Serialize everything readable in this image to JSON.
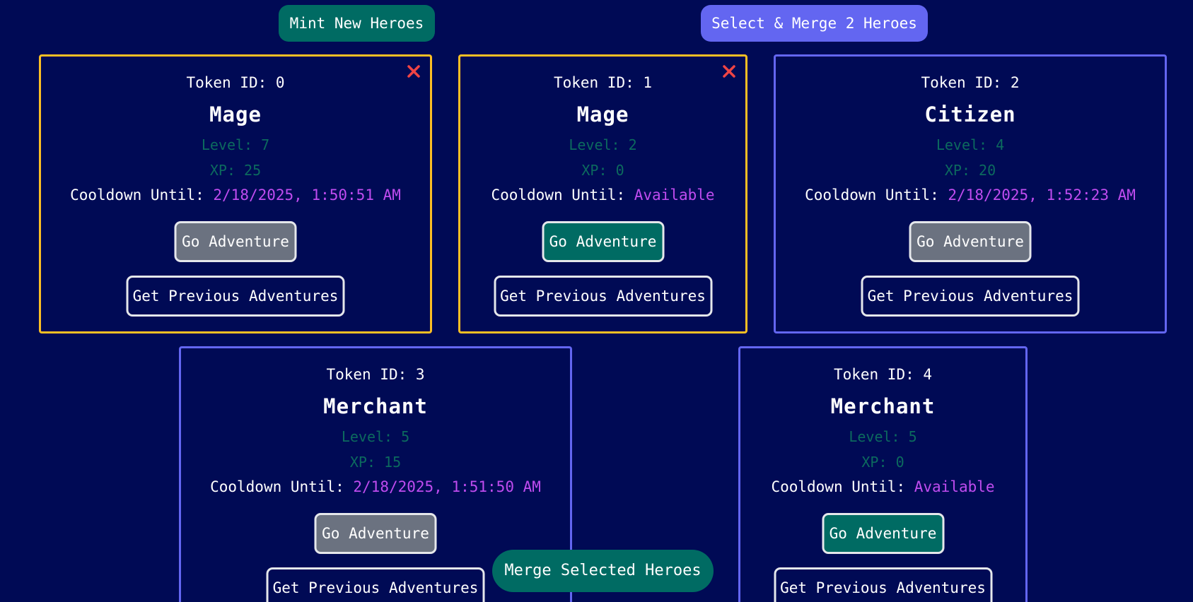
{
  "header": {
    "mint_label": "Mint New Heroes",
    "merge_label": "Select & Merge 2 Heroes"
  },
  "labels": {
    "token_id_prefix": "Token ID: ",
    "level_prefix": "Level: ",
    "xp_prefix": "XP: ",
    "cooldown_prefix": "Cooldown Until: ",
    "adventure_button": "Go Adventure",
    "previous_button": "Get Previous Adventures"
  },
  "heroes": [
    {
      "token_id": "0",
      "class": "Mage",
      "level": "7",
      "xp": "25",
      "cooldown": "2/18/2025, 1:50:51 AM",
      "selected": true,
      "on_cooldown": true
    },
    {
      "token_id": "1",
      "class": "Mage",
      "level": "2",
      "xp": "0",
      "cooldown": "Available",
      "selected": true,
      "on_cooldown": false
    },
    {
      "token_id": "2",
      "class": "Citizen",
      "level": "4",
      "xp": "20",
      "cooldown": "2/18/2025, 1:52:23 AM",
      "selected": false,
      "on_cooldown": true
    },
    {
      "token_id": "3",
      "class": "Merchant",
      "level": "5",
      "xp": "15",
      "cooldown": "2/18/2025, 1:51:50 AM",
      "selected": false,
      "on_cooldown": true
    },
    {
      "token_id": "4",
      "class": "Merchant",
      "level": "5",
      "xp": "0",
      "cooldown": "Available",
      "selected": false,
      "on_cooldown": false
    }
  ],
  "merge_selected_label": "Merge Selected Heroes",
  "icons": {
    "remove": "close-icon"
  },
  "colors": {
    "background": "#000a55",
    "selected_border": "#fbbf24",
    "card_border": "#6366f1",
    "teal_button": "#006b63",
    "indigo_button": "#6366f1",
    "cooldown_value": "#c04cf0",
    "stat_text": "#0c6a5e",
    "disabled_button": "#6b7280",
    "remove_icon": "#ef4444"
  }
}
